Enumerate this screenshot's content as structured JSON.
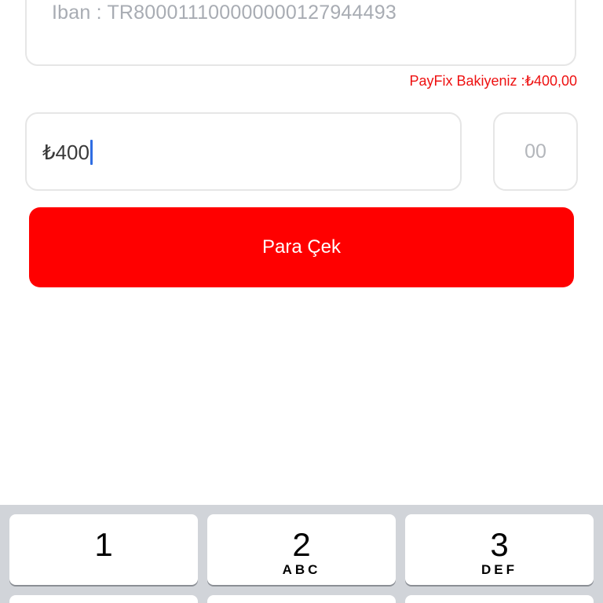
{
  "form": {
    "iban_text": "Iban : TR800011100000000127944493",
    "balance_text": "PayFix Bakiyeniz :₺400,00",
    "amount_value": "₺400",
    "cents_placeholder": "00",
    "withdraw_label": "Para Çek"
  },
  "keyboard": {
    "keys": [
      {
        "number": "1",
        "letters": ""
      },
      {
        "number": "2",
        "letters": "ABC"
      },
      {
        "number": "3",
        "letters": "DEF"
      }
    ]
  },
  "colors": {
    "accent": "#ff0000",
    "balance_text": "#ee1111",
    "caret": "#2f6de2",
    "keyboard_bg": "#d1d4d9"
  }
}
